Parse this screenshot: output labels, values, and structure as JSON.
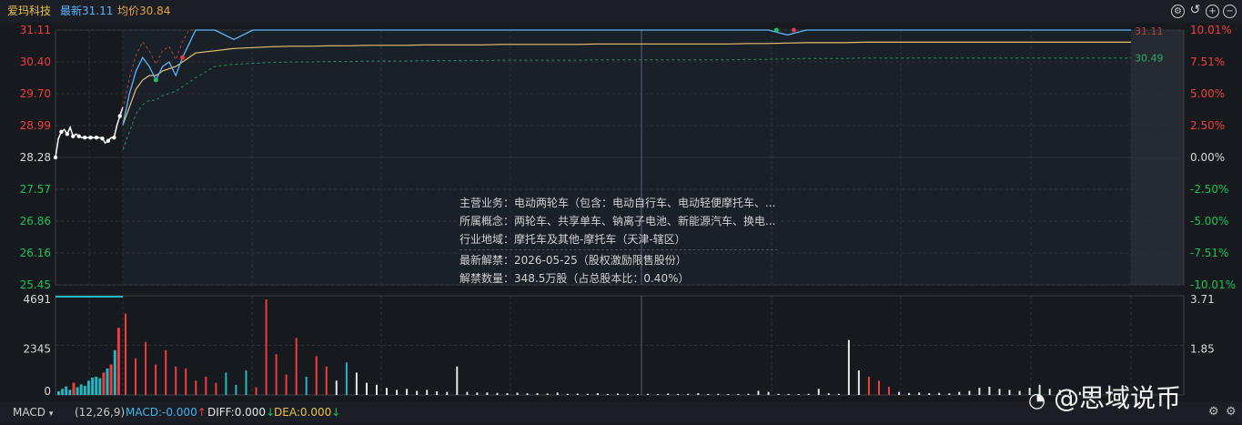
{
  "header": {
    "name": "爱玛科技",
    "latest": "最新31.11",
    "avg": "均价30.84"
  },
  "icons": [
    "settings-circle-icon",
    "undo-icon",
    "zoom-in-icon",
    "zoom-out-icon"
  ],
  "colors": {
    "up": "#f03c3c",
    "down": "#17c45a",
    "price": "#5ab4ff",
    "avg": "#e8c070",
    "bg": "#16191e"
  },
  "chart_data": {
    "type": "line",
    "price_axis_labels": [
      "31.11",
      "30.40",
      "29.70",
      "28.99",
      "28.28",
      "27.57",
      "26.86",
      "26.16",
      "25.45"
    ],
    "pct_axis_labels": [
      "10.01%",
      "7.51%",
      "5.00%",
      "2.50%",
      "0.00%",
      "-2.50%",
      "-5.00%",
      "-7.51%",
      "-10.01%"
    ],
    "ylim": [
      25.45,
      31.11
    ],
    "base_price": 28.28,
    "price_end_label": "31.11",
    "avg_end_label": "30.49",
    "preopen_series": [
      28.28,
      28.7,
      28.85,
      28.9,
      28.8,
      28.95,
      28.75,
      28.8,
      28.75,
      28.72,
      28.72,
      28.72,
      28.72,
      28.72,
      28.72,
      28.72,
      28.7,
      28.6,
      28.65,
      28.72,
      28.72,
      29.0,
      29.2,
      29.4
    ],
    "series": [
      {
        "values": [
          29.0,
          29.7,
          30.2,
          30.5,
          30.3,
          30.0,
          30.3,
          30.4,
          30.1,
          30.5,
          30.8,
          31.11,
          31.11,
          30.9,
          31.11,
          31.11,
          31.11,
          31.11,
          31.11,
          31.11,
          31.11,
          31.11,
          31.11,
          31.11,
          31.11,
          31.11,
          31.11,
          31.11,
          31.11,
          31.11,
          31.11,
          31.11,
          31.11,
          31.11,
          31.11,
          31.11,
          31.11,
          31.11,
          31.11,
          31.11,
          31.11,
          31.11,
          31.0,
          31.11,
          31.11,
          31.11,
          31.11,
          31.11,
          31.11,
          31.11,
          31.11,
          31.11,
          31.11,
          31.11,
          31.11,
          31.11,
          31.11,
          31.11,
          31.11,
          31.11,
          31.11
        ]
      },
      {
        "values": [
          29.0,
          29.4,
          29.8,
          30.0,
          30.1,
          30.1,
          30.2,
          30.25,
          30.3,
          30.4,
          30.5,
          30.6,
          30.65,
          30.7,
          30.72,
          30.74,
          30.75,
          30.75,
          30.76,
          30.76,
          30.77,
          30.77,
          30.77,
          30.78,
          30.78,
          30.78,
          30.78,
          30.79,
          30.79,
          30.79,
          30.79,
          30.79,
          30.8,
          30.8,
          30.8,
          30.8,
          30.8,
          30.8,
          30.8,
          30.8,
          30.81,
          30.81,
          30.82,
          30.83,
          30.83,
          30.83,
          30.84,
          30.84,
          30.84,
          30.84,
          30.84,
          30.84,
          30.84,
          30.84,
          30.84,
          30.84,
          30.84,
          30.84,
          30.84,
          30.84,
          30.84
        ]
      }
    ],
    "volume_axis_labels": [
      "4691",
      "2345",
      "0"
    ],
    "volume_right_labels": [
      "3.71",
      "1.85"
    ],
    "volume_ylim": [
      0,
      4691
    ],
    "volume_bars": [
      {
        "v": 180,
        "c": "d"
      },
      {
        "v": 300,
        "c": "d"
      },
      {
        "v": 420,
        "c": "d"
      },
      {
        "v": 250,
        "c": "d"
      },
      {
        "v": 600,
        "c": "u"
      },
      {
        "v": 380,
        "c": "d"
      },
      {
        "v": 520,
        "c": "d"
      },
      {
        "v": 450,
        "c": "d"
      },
      {
        "v": 700,
        "c": "d"
      },
      {
        "v": 850,
        "c": "d"
      },
      {
        "v": 900,
        "c": "d"
      },
      {
        "v": 820,
        "c": "d"
      },
      {
        "v": 1100,
        "c": "u"
      },
      {
        "v": 1300,
        "c": "d"
      },
      {
        "v": 1500,
        "c": "u"
      },
      {
        "v": 2200,
        "c": "d"
      },
      {
        "v": 3300,
        "c": "u"
      },
      {
        "v": 4000,
        "c": "u"
      },
      {
        "v": 1800,
        "c": "u"
      },
      {
        "v": 2600,
        "c": "u"
      },
      {
        "v": 1500,
        "c": "u"
      },
      {
        "v": 2200,
        "c": "u"
      },
      {
        "v": 1400,
        "c": "u"
      },
      {
        "v": 1300,
        "c": "u"
      },
      {
        "v": 700,
        "c": "u"
      },
      {
        "v": 900,
        "c": "u"
      },
      {
        "v": 600,
        "c": "u"
      },
      {
        "v": 1100,
        "c": "d"
      },
      {
        "v": 500,
        "c": "d"
      },
      {
        "v": 1200,
        "c": "d"
      },
      {
        "v": 380,
        "c": "u"
      },
      {
        "v": 4691,
        "c": "u"
      },
      {
        "v": 2000,
        "c": "u"
      },
      {
        "v": 1000,
        "c": "u"
      },
      {
        "v": 2800,
        "c": "u"
      },
      {
        "v": 900,
        "c": "d"
      },
      {
        "v": 1900,
        "c": "u"
      },
      {
        "v": 1400,
        "c": "u"
      },
      {
        "v": 700,
        "c": "w"
      },
      {
        "v": 1600,
        "c": "d"
      },
      {
        "v": 1100,
        "c": "w"
      },
      {
        "v": 600,
        "c": "w"
      },
      {
        "v": 500,
        "c": "w"
      },
      {
        "v": 350,
        "c": "w"
      },
      {
        "v": 250,
        "c": "w"
      },
      {
        "v": 300,
        "c": "w"
      },
      {
        "v": 200,
        "c": "w"
      },
      {
        "v": 250,
        "c": "w"
      },
      {
        "v": 180,
        "c": "w"
      },
      {
        "v": 150,
        "c": "w"
      },
      {
        "v": 1400,
        "c": "w"
      },
      {
        "v": 150,
        "c": "w"
      },
      {
        "v": 120,
        "c": "w"
      },
      {
        "v": 120,
        "c": "w"
      },
      {
        "v": 100,
        "c": "w"
      },
      {
        "v": 90,
        "c": "w"
      },
      {
        "v": 110,
        "c": "w"
      },
      {
        "v": 80,
        "c": "w"
      },
      {
        "v": 90,
        "c": "w"
      },
      {
        "v": 70,
        "c": "w"
      },
      {
        "v": 120,
        "c": "w"
      },
      {
        "v": 60,
        "c": "w"
      },
      {
        "v": 70,
        "c": "w"
      },
      {
        "v": 60,
        "c": "w"
      },
      {
        "v": 90,
        "c": "w"
      },
      {
        "v": 50,
        "c": "w"
      },
      {
        "v": 70,
        "c": "w"
      },
      {
        "v": 60,
        "c": "w"
      },
      {
        "v": 50,
        "c": "w"
      },
      {
        "v": 60,
        "c": "w"
      },
      {
        "v": 40,
        "c": "w"
      },
      {
        "v": 70,
        "c": "w"
      },
      {
        "v": 50,
        "c": "w"
      },
      {
        "v": 60,
        "c": "w"
      },
      {
        "v": 90,
        "c": "w"
      },
      {
        "v": 50,
        "c": "w"
      },
      {
        "v": 60,
        "c": "w"
      },
      {
        "v": 40,
        "c": "w"
      },
      {
        "v": 50,
        "c": "w"
      },
      {
        "v": 60,
        "c": "w"
      },
      {
        "v": 200,
        "c": "w"
      },
      {
        "v": 150,
        "c": "w"
      },
      {
        "v": 60,
        "c": "w"
      },
      {
        "v": 50,
        "c": "w"
      },
      {
        "v": 40,
        "c": "w"
      },
      {
        "v": 60,
        "c": "w"
      },
      {
        "v": 300,
        "c": "w"
      },
      {
        "v": 80,
        "c": "w"
      },
      {
        "v": 60,
        "c": "w"
      },
      {
        "v": 2700,
        "c": "w"
      },
      {
        "v": 1200,
        "c": "w"
      },
      {
        "v": 900,
        "c": "u"
      },
      {
        "v": 700,
        "c": "u"
      },
      {
        "v": 400,
        "c": "u"
      },
      {
        "v": 150,
        "c": "w"
      },
      {
        "v": 100,
        "c": "w"
      },
      {
        "v": 120,
        "c": "w"
      },
      {
        "v": 90,
        "c": "w"
      },
      {
        "v": 100,
        "c": "w"
      },
      {
        "v": 80,
        "c": "w"
      },
      {
        "v": 150,
        "c": "w"
      },
      {
        "v": 200,
        "c": "w"
      },
      {
        "v": 350,
        "c": "w"
      },
      {
        "v": 400,
        "c": "w"
      },
      {
        "v": 300,
        "c": "w"
      },
      {
        "v": 250,
        "c": "w"
      },
      {
        "v": 200,
        "c": "w"
      },
      {
        "v": 350,
        "c": "w"
      },
      {
        "v": 500,
        "c": "w"
      },
      {
        "v": 300,
        "c": "w"
      },
      {
        "v": 250,
        "c": "w"
      },
      {
        "v": 200,
        "c": "w"
      },
      {
        "v": 150,
        "c": "w"
      },
      {
        "v": 120,
        "c": "w"
      },
      {
        "v": 100,
        "c": "w"
      },
      {
        "v": 90,
        "c": "w"
      },
      {
        "v": 80,
        "c": "w"
      }
    ]
  },
  "info": {
    "business": "主营业务：电动两轮车（包含：电动自行车、电动轻便摩托车、...",
    "concept": "所属概念：两轮车、共享单车、钠离子电池、新能源汽车、换电...",
    "region": "行业地域：摩托车及其他-摩托车（天津-辖区）",
    "unlock_date": "最新解禁：2026-05-25（股权激励限售股份）",
    "unlock_qty": "解禁数量：348.5万股（占总股本比：0.40%）"
  },
  "footer": {
    "indicator": "MACD",
    "params": "(12,26,9)",
    "macd": "MACD:-0.000",
    "diff": "DIFF:0.000",
    "dea": "DEA:0.000"
  },
  "watermark": "@思域说币"
}
